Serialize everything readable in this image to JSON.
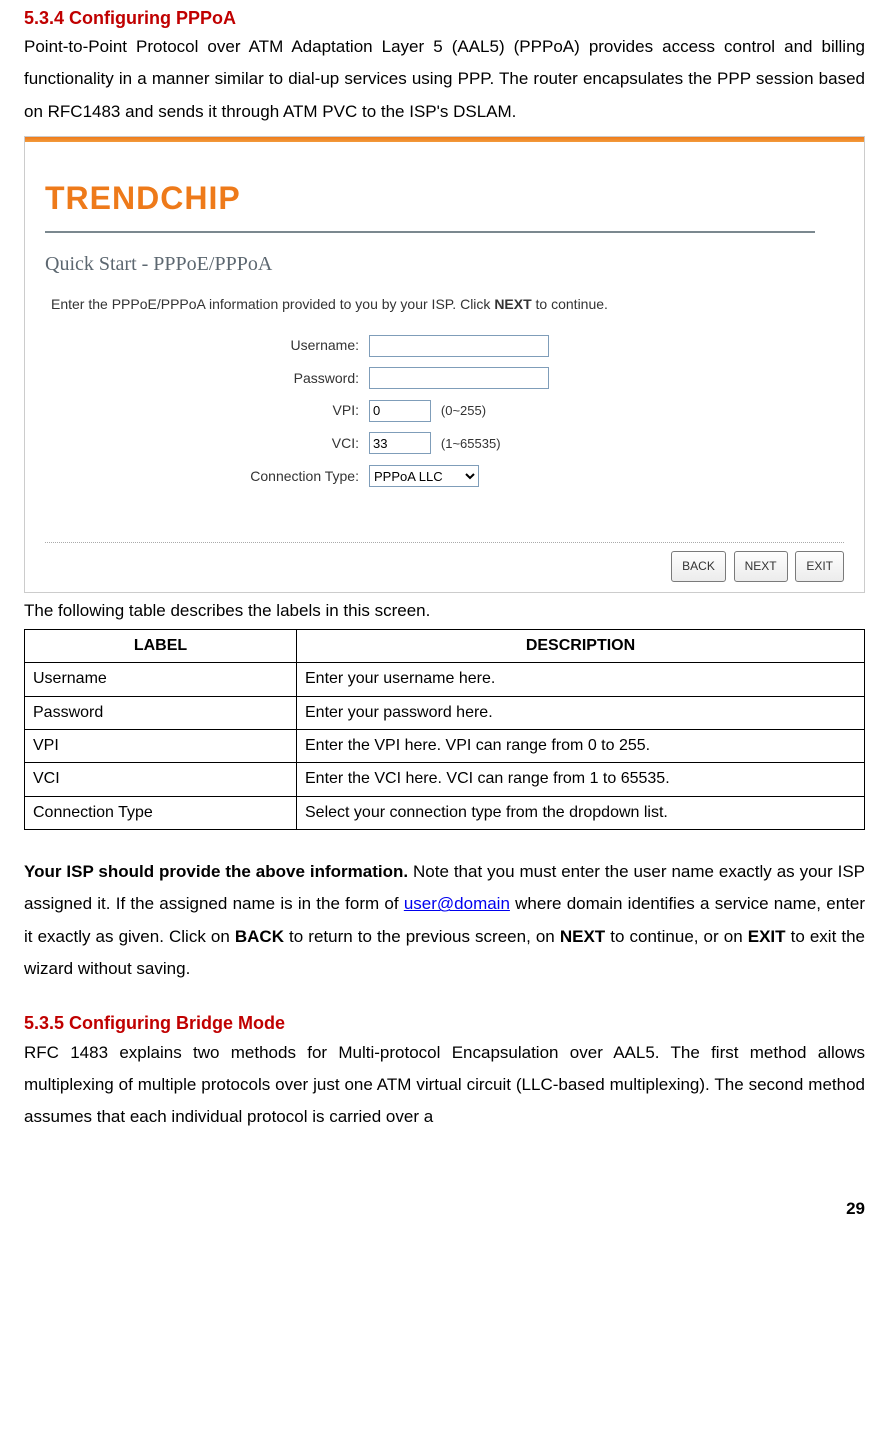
{
  "section1": {
    "heading": "5.3.4 Configuring PPPoA",
    "para": "Point-to-Point Protocol over ATM Adaptation Layer 5 (AAL5) (PPPoA) provides access control and billing functionality in a manner similar to dial-up services using PPP. The router encapsulates the PPP session based on RFC1483 and sends it through ATM PVC to the ISP's DSLAM."
  },
  "panel": {
    "logo": "TRENDCHIP",
    "subtitle": "Quick Start - PPPoE/PPPoA",
    "instr_text_a": "Enter the PPPoE/PPPoA information provided to you by your ISP. Click ",
    "instr_text_bold": "NEXT",
    "instr_text_b": " to continue.",
    "fields": {
      "username_label": "Username:",
      "username_value": "",
      "password_label": "Password:",
      "password_value": "",
      "vpi_label": "VPI:",
      "vpi_value": "0",
      "vpi_hint": "(0~255)",
      "vci_label": "VCI:",
      "vci_value": "33",
      "vci_hint": "(1~65535)",
      "conn_label": "Connection Type:",
      "conn_value": "PPPoA LLC"
    },
    "buttons": {
      "back": "BACK",
      "next": "NEXT",
      "exit": "EXIT"
    }
  },
  "table_intro": "The following table describes the labels in this screen.",
  "table": {
    "h1": "LABEL",
    "h2": "DESCRIPTION",
    "rows": [
      {
        "label": "Username",
        "desc": "Enter your username here."
      },
      {
        "label": "Password",
        "desc": "Enter your password here."
      },
      {
        "label": "VPI",
        "desc": "Enter the VPI here. VPI can range from 0 to 255."
      },
      {
        "label": "VCI",
        "desc": "Enter the VCI here. VCI can range from 1 to 65535."
      },
      {
        "label": "Connection Type",
        "desc": "Select your connection type from the dropdown list."
      }
    ]
  },
  "note": {
    "bold_lead": "Your ISP should provide the above information.",
    "t1": " Note that you must enter the user name exactly as your ISP assigned it. If the assigned name is in the form of ",
    "link": "user@domain",
    "t2": " where domain identifies a service name, enter it exactly as given. Click on ",
    "b1": "BACK",
    "t3": " to return to the previous screen, on ",
    "b2": "NEXT",
    "t4": " to continue, or on ",
    "b3": "EXIT",
    "t5": " to exit the wizard without saving."
  },
  "section2": {
    "heading": "5.3.5 Configuring Bridge Mode",
    "para": "RFC 1483 explains two methods for Multi-protocol Encapsulation over AAL5. The first method allows multiplexing of multiple protocols over just one ATM virtual circuit (LLC-based multiplexing). The second method assumes that each individual protocol is carried over a"
  },
  "page_number": "29"
}
